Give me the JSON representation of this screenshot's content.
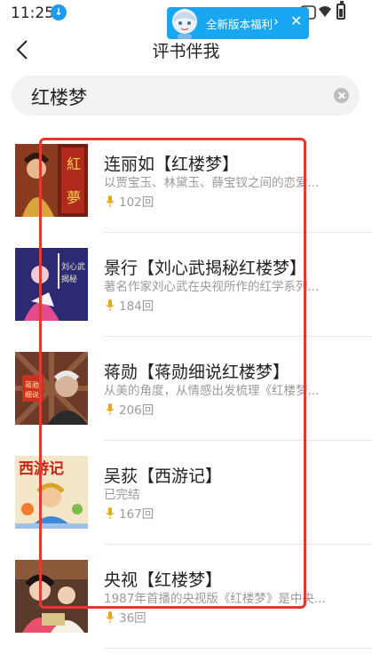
{
  "status_bar": {
    "time": "11:25"
  },
  "promo": {
    "text": "全新版本福利"
  },
  "nav": {
    "title": "评书伴我"
  },
  "search": {
    "query": "红楼梦"
  },
  "results": [
    {
      "title": "连丽如【红楼梦】",
      "desc": "以贾宝玉、林黛玉、薛宝钗之间的恋爱...",
      "count": "102回"
    },
    {
      "title": "景行【刘心武揭秘红楼梦】",
      "desc": "著名作家刘心武在央视所作的红学系列...",
      "count": "184回"
    },
    {
      "title": "蒋勋【蒋勋细说红楼梦】",
      "desc": "从美的角度，从情感出发梳理《红楼梦...",
      "count": "206回"
    },
    {
      "title": "吴荻【西游记】",
      "desc": "已完结",
      "count": "167回"
    },
    {
      "title": "央视【红楼梦】",
      "desc": "1987年首播的央视版《红楼梦》是中央...",
      "count": "36回"
    }
  ],
  "colors": {
    "accent": "#1aa7f2",
    "highlight": "#e23b2e"
  }
}
